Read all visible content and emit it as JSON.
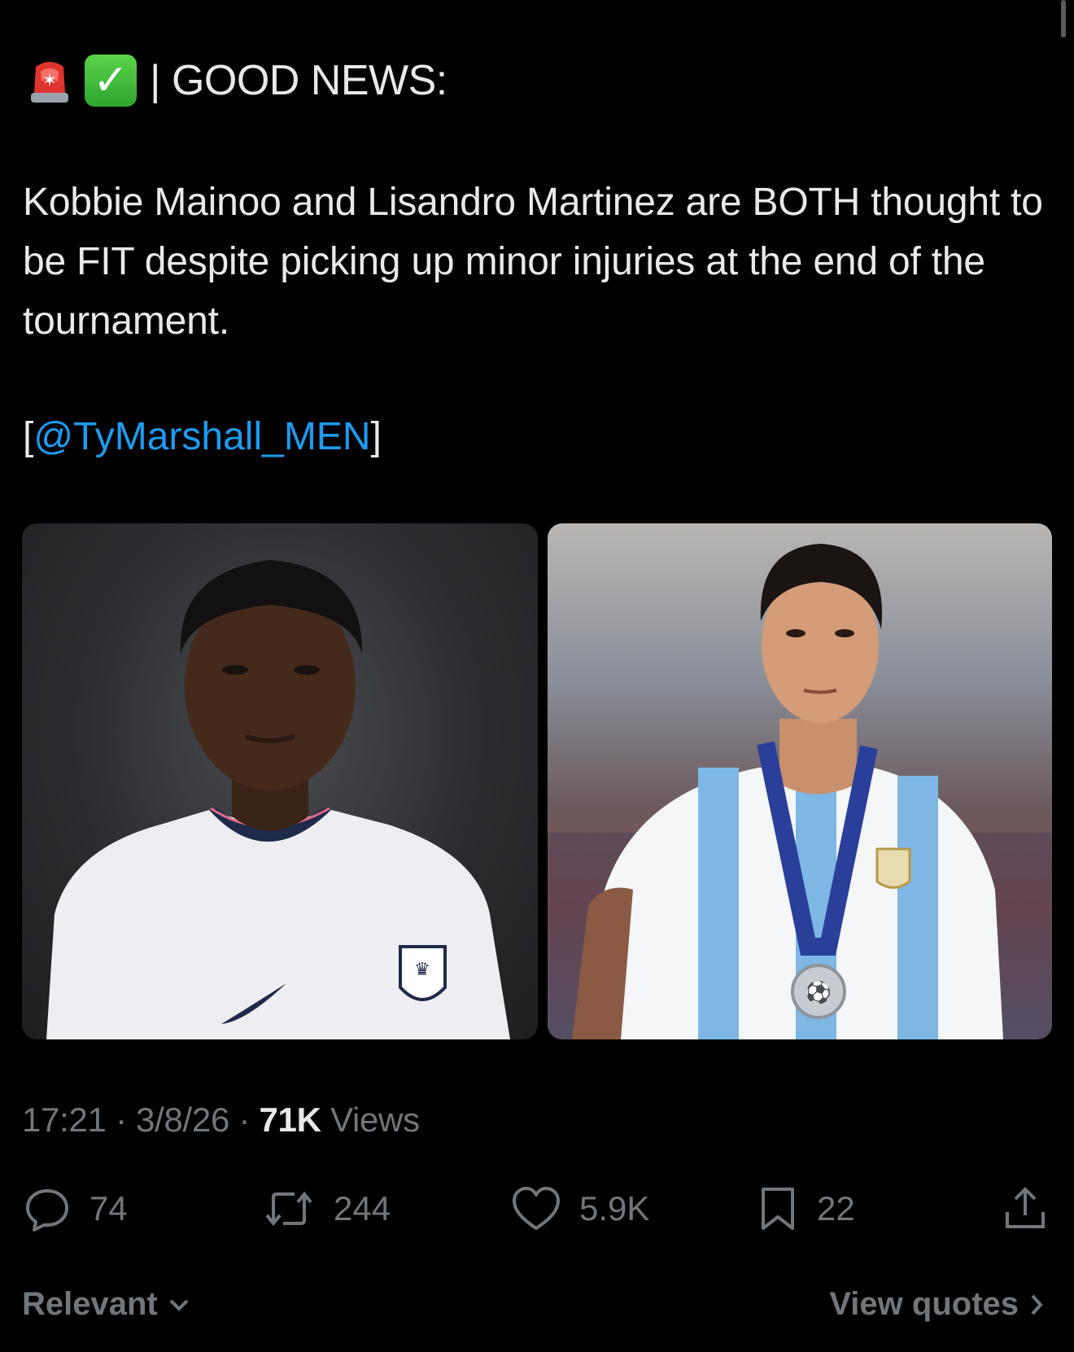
{
  "post": {
    "headline": "| GOOD NEWS:",
    "body": "Kobbie Mainoo and Lisandro Martinez are BOTH thought to be FIT despite picking up minor injuries at the end of the tournament.",
    "mention_open": "[",
    "mention": "@TyMarshall_MEN",
    "mention_close": "]",
    "time": "17:21",
    "date": "3/8/26",
    "views_count": "71K",
    "views_label": "Views"
  },
  "actions": {
    "replies": "74",
    "reposts": "244",
    "likes": "5.9K",
    "bookmarks": "22"
  },
  "footer": {
    "sort_label": "Relevant",
    "view_quotes_label": "View quotes"
  },
  "colors": {
    "background": "#000000",
    "text": "#e7e9ea",
    "muted": "#71767b",
    "link": "#1d9bf0"
  }
}
